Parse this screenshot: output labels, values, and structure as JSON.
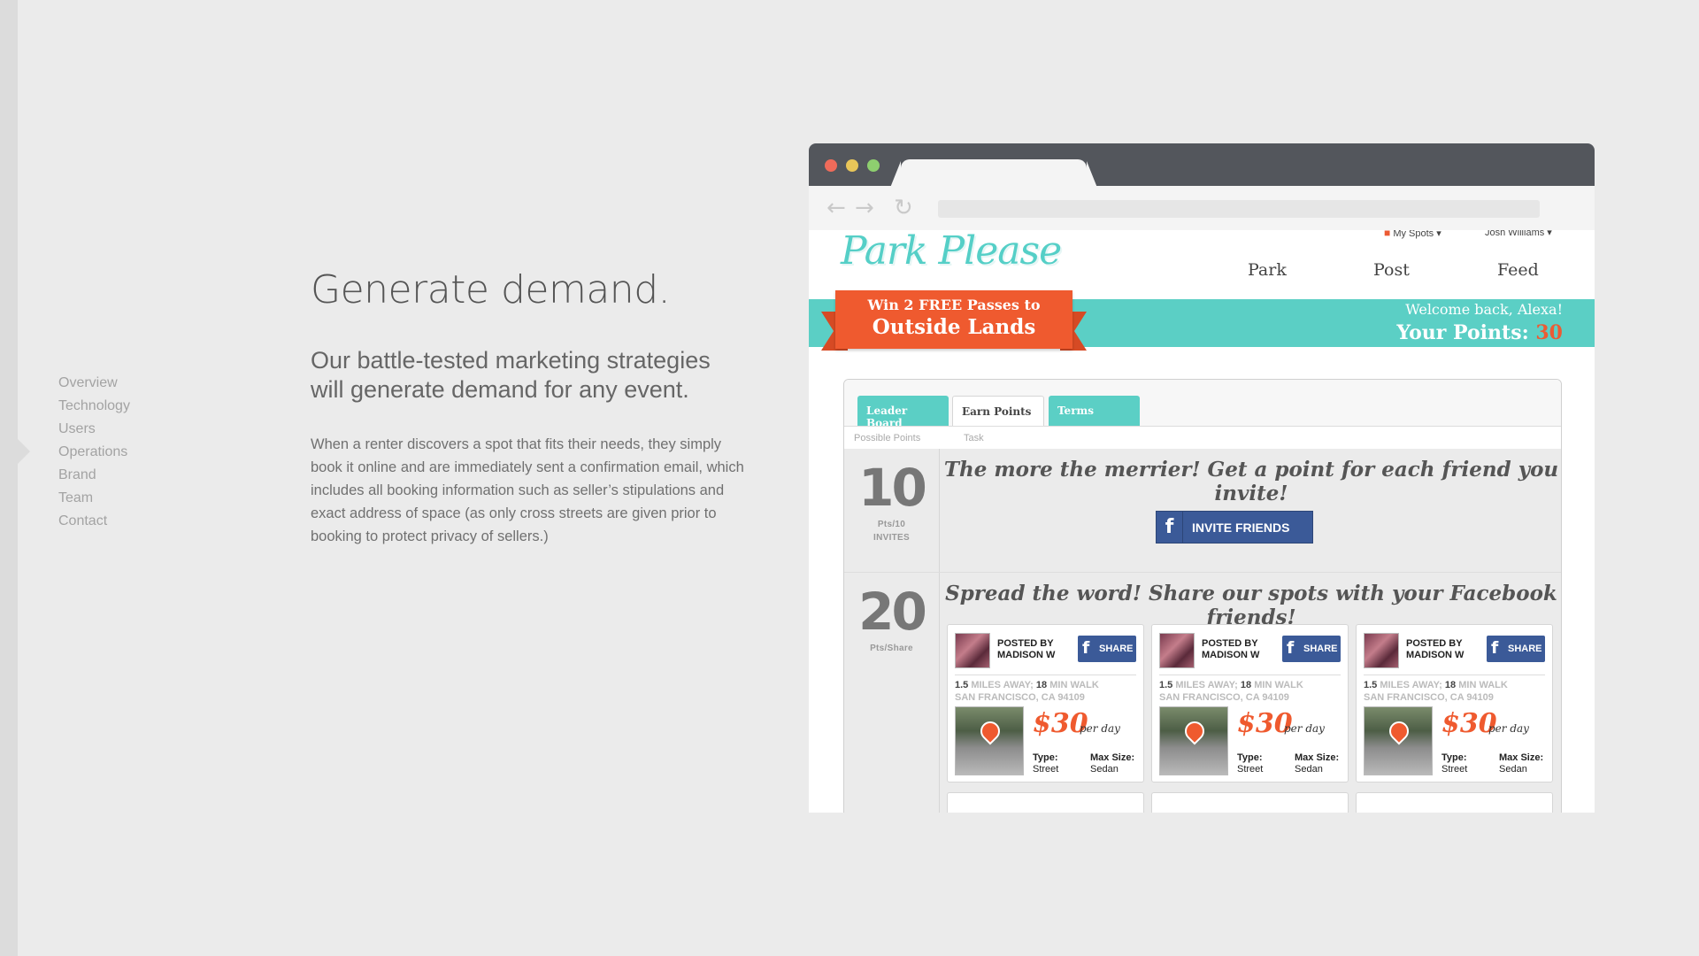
{
  "side_nav": [
    "Overview",
    "Technology",
    "Users",
    "Operations",
    "Brand",
    "Team",
    "Contact"
  ],
  "content": {
    "headline": "Generate demand.",
    "subhead": "Our battle-tested marketing strategies will generate demand for any event.",
    "body": "When a renter discovers a spot that fits their needs, they simply book it online and are immediately sent a confirmation email, which includes all booking information such as seller’s stipulations and exact address of space (as only cross streets are given prior to booking to protect privacy of sellers.)"
  },
  "browser": {
    "icons": {
      "back": "←",
      "forward": "→",
      "reload": "↻"
    }
  },
  "site": {
    "logo": "Park Please",
    "my_spots": "My Spots",
    "user_name": "Josh Williams",
    "nav": [
      "Park",
      "Post",
      "Feed"
    ],
    "promo_line1": "Win 2 FREE Passes to",
    "promo_line2": "Outside Lands",
    "welcome": "Welcome back, Alexa!",
    "points_label": "Your Points:",
    "points_value": "30",
    "tabs": [
      "Leader Board",
      "Earn Points",
      "Terms"
    ],
    "col_possible": "Possible Points",
    "col_task": "Task",
    "task1": {
      "points": "10",
      "label1": "Pts/10",
      "label2": "Invites",
      "text": "The more the merrier! Get a point for each friend you invite!",
      "button": "INVITE FRIENDS"
    },
    "task2": {
      "points": "20",
      "label1": "Pts/Share",
      "text": "Spread the word! Share our spots with your Facebook friends!"
    },
    "card": {
      "posted_by": "POSTED BY",
      "poster": "MADISON W",
      "share": "SHARE",
      "miles": "1.5",
      "miles_text": "MILES AWAY;",
      "walk": "18",
      "walk_text": "MIN WALK",
      "location": "SAN FRANCISCO, CA 94109",
      "price": "$30",
      "per_day": "per day",
      "type_label": "Type:",
      "type_value": "Street",
      "size_label": "Max Size:",
      "size_value": "Sedan"
    }
  },
  "colors": {
    "teal": "#5bcfc5",
    "orange": "#ef5a2f",
    "facebook": "#3b5a98"
  }
}
